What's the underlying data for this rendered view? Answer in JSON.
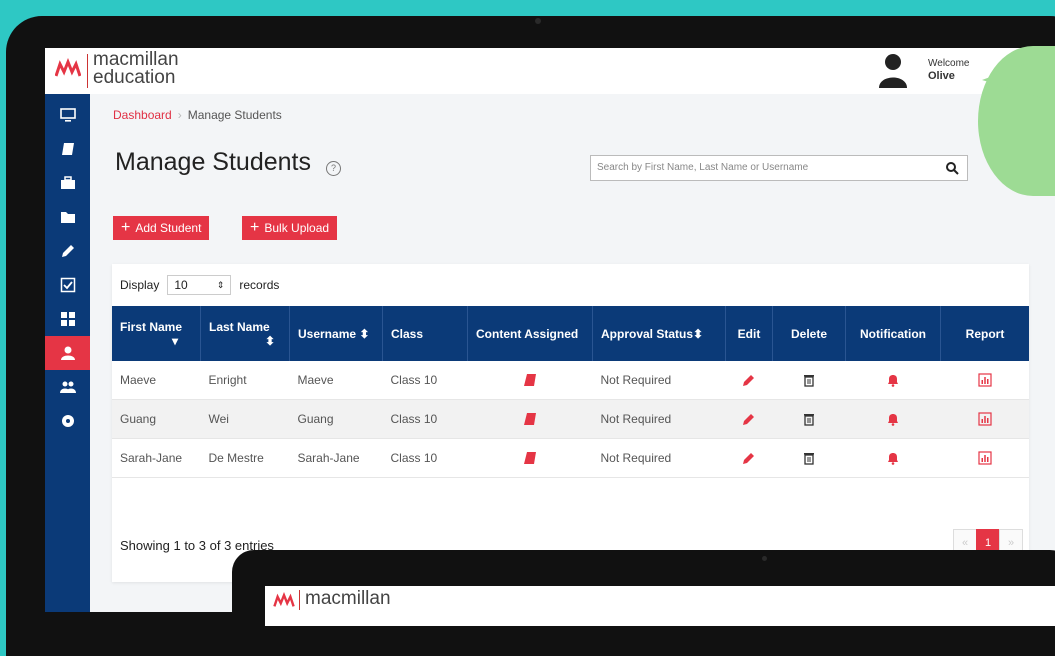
{
  "brand": {
    "line1": "macmillan",
    "line2": "education",
    "accent": "#e53545",
    "navy": "#0b3a78"
  },
  "user": {
    "welcome": "Welcome",
    "name": "Olive"
  },
  "breadcrumb": {
    "home": "Dashboard",
    "current": "Manage Students"
  },
  "page": {
    "title": "Manage Students"
  },
  "search": {
    "placeholder": "Search by First Name, Last Name or Username"
  },
  "actions": {
    "add_student": "Add Student",
    "bulk_upload": "Bulk Upload"
  },
  "display": {
    "prefix": "Display",
    "value": "10",
    "suffix": "records"
  },
  "table": {
    "headers": [
      "First Name",
      "Last Name",
      "Username",
      "Class",
      "Content Assigned",
      "Approval Status",
      "Edit",
      "Delete",
      "Notification",
      "Report"
    ],
    "rows": [
      {
        "first": "Maeve",
        "last": "Enright",
        "username": "Maeve",
        "class": "Class 10",
        "approval": "Not Required"
      },
      {
        "first": "Guang",
        "last": "Wei",
        "username": "Guang",
        "class": "Class 10",
        "approval": "Not Required"
      },
      {
        "first": "Sarah-Jane",
        "last": "De Mestre",
        "username": "Sarah-Jane",
        "class": "Class 10",
        "approval": "Not Required"
      }
    ]
  },
  "footer": {
    "showing": "Showing 1 to 3 of 3 entries"
  },
  "pagination": {
    "prev": "«",
    "current": "1",
    "next": "»"
  },
  "second_screen": {
    "brand": "macmillan"
  },
  "sidebar": {
    "items": [
      "monitor-icon",
      "book-icon",
      "briefcase-icon",
      "folder-icon",
      "pencil-icon",
      "checkbox-icon",
      "grid-icon",
      "user-icon",
      "users-icon",
      "circle-icon"
    ],
    "active_index": 7
  }
}
